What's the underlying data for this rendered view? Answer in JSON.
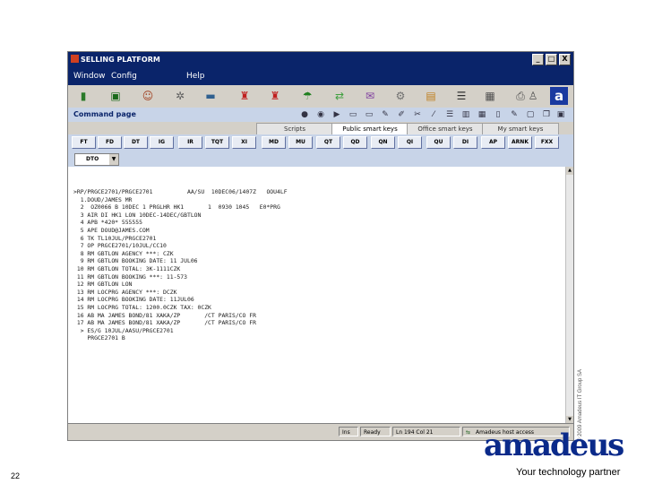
{
  "window": {
    "title": "SELLING PLATFORM",
    "controls": [
      "_",
      "□",
      "X"
    ]
  },
  "menu": [
    "Window",
    "Config",
    "Help"
  ],
  "toolbar_icons": [
    "book-icon",
    "terminal-icon",
    "person-icon",
    "settings-icon",
    "car-icon",
    "agent-icon",
    "agent2-icon",
    "umbrella-icon",
    "arrows-icon",
    "gift-icon",
    "gear-icon",
    "card-icon",
    "bars-icon",
    "clipboard-icon",
    "printer-icon",
    "shirt-icon",
    "clipboard2-icon"
  ],
  "logo_letter": "a",
  "command_page": {
    "label": "Command page"
  },
  "tabs": [
    {
      "label": "Scripts",
      "selected": false
    },
    {
      "label": "Public smart keys",
      "selected": true
    },
    {
      "label": "Office smart keys",
      "selected": false
    },
    {
      "label": "My smart keys",
      "selected": false
    }
  ],
  "keys": [
    "FT",
    "FD",
    "DT",
    "IG",
    "IR",
    "TQT",
    "XI",
    "MD",
    "MU",
    "QT",
    "QD",
    "QN",
    "QI",
    "QU",
    "DI",
    "AP",
    "ARNK",
    "FXX"
  ],
  "dropdown": {
    "value": "DTO"
  },
  "screen_lines": [
    ">RP/PRGCE2701/PRGCE2701          AA/SU  10DEC06/1407Z   OOU4LF",
    "  1.DOUD/JAMES MR",
    "  2  OZ0066 B 10DEC 1 PRGLHR HK1       1  0930 1045   E0*PRG",
    "  3 AIR DI HK1 LON 10DEC-14DEC/GBTLON",
    "  4 APB *420* 555555",
    "  5 APE DOUD@JAMES.COM",
    "  6 TK TL10JUL/PRGCE2701",
    "  7 OP PRGCE2701/10JUL/CC10",
    "  8 RM GBTLON AGENCY ***: CZK",
    "  9 RM GBTLON BOOKING DATE: 11 JUL06",
    " 10 RM GBTLON TOTAL: 3K-1111CZK",
    " 11 RM GBTLON BOOKING ***: 11-573",
    " 12 RM GBTLON LON",
    " 13 RM LOCPRG AGENCY ***: DCZK",
    " 14 RM LOCPRG BOOKING DATE: 11JUL06",
    " 15 RM LOCPRG TOTAL: 1200.0CZK TAX: 0CZK",
    " 16 AB MA JAMES BOND/81 XAKA/ZP       /CT PARIS/CO FR",
    " 17 AB MA JAMES BOND/81 XAKA/ZP       /CT PARIS/CO FR",
    "  > ES/G 10JUL/AASU/PRGCE2701",
    "    PRGCE2701 B"
  ],
  "status": {
    "mode": "Ins",
    "state": "Ready",
    "position": "Ln 194 Col 21",
    "service": "Amadeus host access"
  },
  "slide": {
    "copyright": "© 2009 Amadeus IT Group SA",
    "page_number": "22",
    "brand": "amadeus",
    "tagline": "Your technology partner"
  },
  "colors": {
    "title_bar": "#0a246a",
    "header_band": "#c8d4e8",
    "brand_blue": "#0a2a8a"
  }
}
